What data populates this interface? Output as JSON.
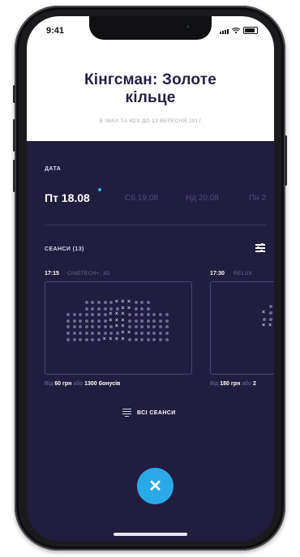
{
  "status_bar": {
    "time": "9:41"
  },
  "movie": {
    "title_line1": "Кінгсман: Золоте",
    "title_line2": "кільце",
    "subtitle": "В IMAX ТА 4DX ДО 13 ВЕРЕСНЯ 2017"
  },
  "date_section": {
    "label": "ДАТА",
    "dates": [
      {
        "label": "Пт 18.08",
        "selected": true
      },
      {
        "label": "Сб 19.08",
        "selected": false
      },
      {
        "label": "Нд 20.08",
        "selected": false
      },
      {
        "label": "Пн 2",
        "selected": false
      }
    ]
  },
  "sessions": {
    "label": "СЕАНСИ (13)",
    "cards": [
      {
        "time": "17:15",
        "cinema": "CINETECH+, 3D",
        "price_prefix": "Від",
        "price": "60 грн",
        "price_or": "або",
        "bonus": "1300 бонусів"
      },
      {
        "time": "17:30",
        "cinema": "RELUX",
        "price_prefix": "Від",
        "price": "180 грн",
        "price_or": "або",
        "bonus": "2"
      }
    ],
    "all_label": "ВСІ СЕАНСИ"
  },
  "close_button": {
    "symbol": "✕"
  },
  "colors": {
    "background": "#211d3f",
    "accent": "#2aa9e8",
    "title": "#231f44"
  },
  "icons": [
    "signal-icon",
    "wifi-icon",
    "battery-icon",
    "filter-icon",
    "list-icon",
    "close-icon"
  ]
}
